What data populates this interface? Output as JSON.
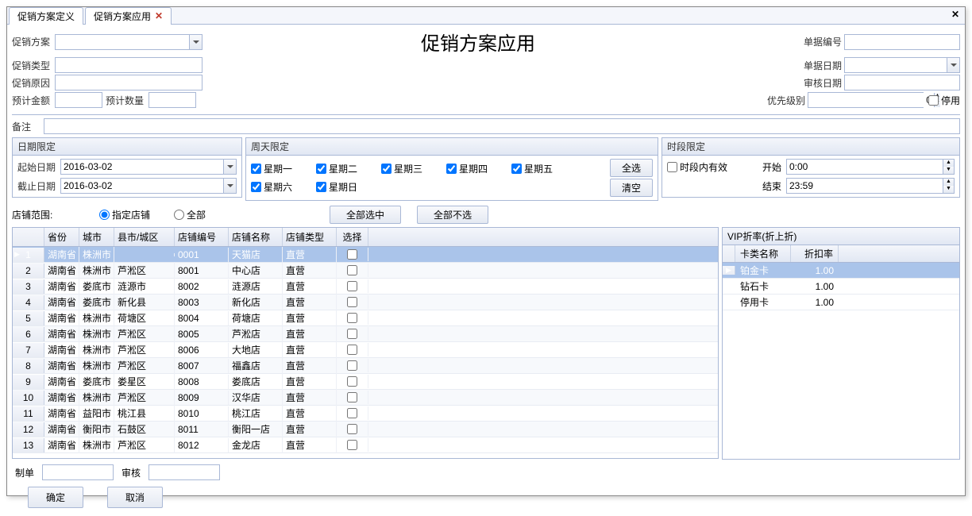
{
  "tabs": {
    "definition": "促销方案定义",
    "application": "促销方案应用"
  },
  "page_title": "促销方案应用",
  "form_left": {
    "plan_label": "促销方案",
    "plan_value": "",
    "type_label": "促销类型",
    "type_value": "",
    "reason_label": "促销原因",
    "reason_value": "",
    "estimate_amount_label": "预计金额",
    "estimate_amount_value": "",
    "estimate_qty_label": "预计数量",
    "estimate_qty_value": "",
    "remark_label": "备注",
    "remark_value": ""
  },
  "form_right": {
    "docno_label": "单据编号",
    "docno_value": "",
    "docdate_label": "单据日期",
    "docdate_value": "",
    "auditdate_label": "审核日期",
    "auditdate_value": "",
    "priority_label": "优先级别",
    "priority_value": "0",
    "disable_label": "停用"
  },
  "date_panel": {
    "title": "日期限定",
    "start_label": "起始日期",
    "start_value": "2016-03-02",
    "end_label": "截止日期",
    "end_value": "2016-03-02"
  },
  "week_panel": {
    "title": "周天限定",
    "days": [
      "星期一",
      "星期二",
      "星期三",
      "星期四",
      "星期五",
      "星期六",
      "星期日"
    ],
    "select_all": "全选",
    "clear": "清空"
  },
  "time_panel": {
    "title": "时段限定",
    "enabled_label": "时段内有效",
    "start_label": "开始",
    "start_value": "0:00",
    "end_label": "结束",
    "end_value": "23:59"
  },
  "store_section": {
    "scope_label": "店铺范围:",
    "radio_specific": "指定店铺",
    "radio_all": "全部",
    "select_all_btn": "全部选中",
    "deselect_all_btn": "全部不选",
    "columns": {
      "province": "省份",
      "city": "城市",
      "district": "县市/城区",
      "code": "店铺编号",
      "name": "店铺名称",
      "type": "店铺类型",
      "check": "选择"
    },
    "rows": [
      {
        "province": "湖南省",
        "city": "株洲市",
        "district": "",
        "code": "0001",
        "name": "天猫店",
        "type": "直营",
        "selected": true
      },
      {
        "province": "湖南省",
        "city": "株洲市",
        "district": "芦淞区",
        "code": "8001",
        "name": "中心店",
        "type": "直营",
        "selected": false
      },
      {
        "province": "湖南省",
        "city": "娄底市",
        "district": "涟源市",
        "code": "8002",
        "name": "涟源店",
        "type": "直营",
        "selected": false
      },
      {
        "province": "湖南省",
        "city": "娄底市",
        "district": "新化县",
        "code": "8003",
        "name": "新化店",
        "type": "直营",
        "selected": false
      },
      {
        "province": "湖南省",
        "city": "株洲市",
        "district": "荷塘区",
        "code": "8004",
        "name": "荷塘店",
        "type": "直营",
        "selected": false
      },
      {
        "province": "湖南省",
        "city": "株洲市",
        "district": "芦淞区",
        "code": "8005",
        "name": "芦淞店",
        "type": "直营",
        "selected": false
      },
      {
        "province": "湖南省",
        "city": "株洲市",
        "district": "芦淞区",
        "code": "8006",
        "name": "大地店",
        "type": "直营",
        "selected": false
      },
      {
        "province": "湖南省",
        "city": "株洲市",
        "district": "芦淞区",
        "code": "8007",
        "name": "福鑫店",
        "type": "直营",
        "selected": false
      },
      {
        "province": "湖南省",
        "city": "娄底市",
        "district": "娄星区",
        "code": "8008",
        "name": "娄底店",
        "type": "直营",
        "selected": false
      },
      {
        "province": "湖南省",
        "city": "株洲市",
        "district": "芦淞区",
        "code": "8009",
        "name": "汉华店",
        "type": "直营",
        "selected": false
      },
      {
        "province": "湖南省",
        "city": "益阳市",
        "district": "桃江县",
        "code": "8010",
        "name": "桃江店",
        "type": "直营",
        "selected": false
      },
      {
        "province": "湖南省",
        "city": "衡阳市",
        "district": "石鼓区",
        "code": "8011",
        "name": "衡阳一店",
        "type": "直营",
        "selected": false
      },
      {
        "province": "湖南省",
        "city": "株洲市",
        "district": "芦淞区",
        "code": "8012",
        "name": "金龙店",
        "type": "直营",
        "selected": false
      }
    ]
  },
  "vip_section": {
    "title": "VIP折率(折上折)",
    "columns": {
      "name": "卡类名称",
      "rate": "折扣率"
    },
    "rows": [
      {
        "name": "铂金卡",
        "rate": "1.00",
        "selected": true
      },
      {
        "name": "钻石卡",
        "rate": "1.00",
        "selected": false
      },
      {
        "name": "停用卡",
        "rate": "1.00",
        "selected": false
      }
    ]
  },
  "footer": {
    "creator_label": "制单",
    "creator_value": "",
    "auditor_label": "审核",
    "auditor_value": "",
    "ok": "确定",
    "cancel": "取消"
  }
}
